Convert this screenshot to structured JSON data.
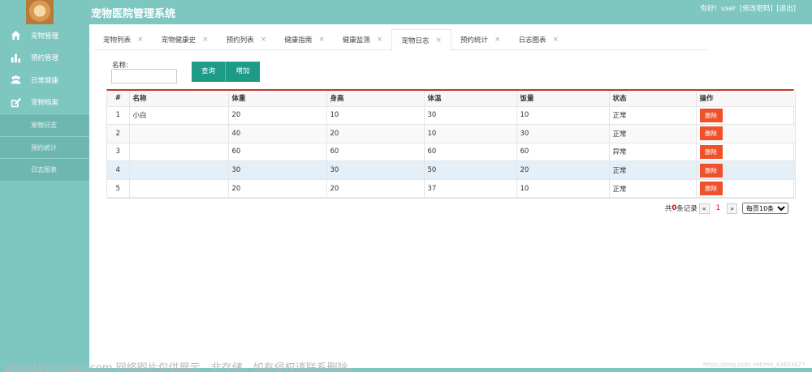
{
  "header": {
    "title": "宠物医院管理系统",
    "greeting": "你好!",
    "username": "user",
    "change_password": "[修改密码]",
    "logout": "[退出]"
  },
  "sidebar": {
    "items": [
      {
        "label": "宠物管理",
        "icon": "home-icon"
      },
      {
        "label": "预约管理",
        "icon": "bar-chart-icon"
      },
      {
        "label": "日常健康",
        "icon": "users-icon"
      },
      {
        "label": "宠物档案",
        "icon": "edit-icon"
      }
    ],
    "subitems": [
      {
        "label": "宠物日志"
      },
      {
        "label": "预约统计"
      },
      {
        "label": "日志图表"
      }
    ]
  },
  "tabs": [
    {
      "label": "宠物列表",
      "close": "×"
    },
    {
      "label": "宠物健康史",
      "close": "×"
    },
    {
      "label": "预约列表",
      "close": "×"
    },
    {
      "label": "健康指南",
      "close": "×"
    },
    {
      "label": "健康监测",
      "close": "×"
    },
    {
      "label": "宠物日志",
      "close": "×",
      "active": true
    },
    {
      "label": "预约统计",
      "close": "×"
    },
    {
      "label": "日志图表",
      "close": "×"
    }
  ],
  "filter": {
    "label": "名称:",
    "value": "",
    "query_button": "查询",
    "add_button": "增加"
  },
  "table": {
    "headers": [
      "#",
      "名称",
      "体重",
      "身高",
      "体温",
      "饭量",
      "状态",
      "操作"
    ],
    "rows": [
      {
        "no": "1",
        "name": "小白",
        "weight": "20",
        "height": "10",
        "temp": "30",
        "food": "10",
        "status": "正常",
        "action": "删除"
      },
      {
        "no": "2",
        "name": "",
        "weight": "40",
        "height": "20",
        "temp": "10",
        "food": "30",
        "status": "正常",
        "action": "删除"
      },
      {
        "no": "3",
        "name": "",
        "weight": "60",
        "height": "60",
        "temp": "60",
        "food": "60",
        "status": "异常",
        "action": "删除"
      },
      {
        "no": "4",
        "name": "",
        "weight": "30",
        "height": "30",
        "temp": "50",
        "food": "20",
        "status": "正常",
        "action": "删除"
      },
      {
        "no": "5",
        "name": "",
        "weight": "20",
        "height": "20",
        "temp": "37",
        "food": "10",
        "status": "正常",
        "action": "删除"
      }
    ]
  },
  "pagination": {
    "prefix": "共",
    "count": "0",
    "suffix": "条记录",
    "prev": "«",
    "current": "1",
    "next": "»",
    "page_size": "每页10条"
  },
  "watermark": {
    "text": "www.toymoban.com 网络图片仅供展示，非存储，如有侵权请联系删除。",
    "csdn": "https://blog.csdn.net/m0_43653477"
  },
  "colors": {
    "teal": "#7ec6c0",
    "button": "#1e9a88",
    "delete": "#f0502a",
    "accent_line": "#c0392b"
  }
}
